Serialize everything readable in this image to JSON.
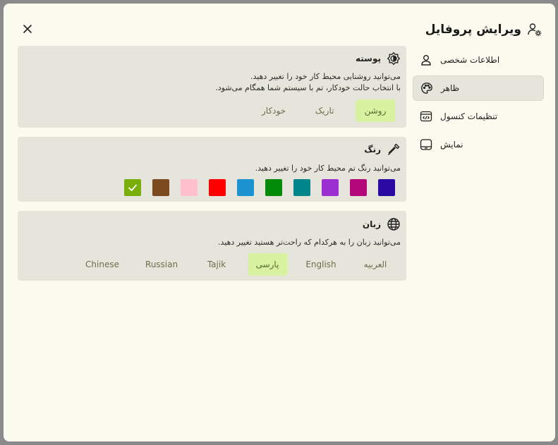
{
  "dialog": {
    "title": "ویرایش پروفایل",
    "title_icon": "user-gear-icon",
    "close_icon": "close-icon"
  },
  "nav": {
    "items": [
      {
        "label": "اطلاعات شخصی",
        "icon": "user-icon",
        "active": false
      },
      {
        "label": "ظاهر",
        "icon": "palette-icon",
        "active": true
      },
      {
        "label": "تنظیمات کنسول",
        "icon": "code-window-icon",
        "active": false
      },
      {
        "label": "نمایش",
        "icon": "display-icon",
        "active": false
      }
    ]
  },
  "skin": {
    "title": "پوسته",
    "icon": "brightness-icon",
    "desc1": "می‌توانید روشنایی محیط کار خود را تغییر دهید.",
    "desc2": "با انتخاب حالت خودکار، تم با سیستم شما همگام می‌شود.",
    "options": [
      "روشن",
      "تاریک",
      "خودکار"
    ],
    "selected": "روشن"
  },
  "color": {
    "title": "رنگ",
    "icon": "eyedropper-icon",
    "desc": "می‌توانید رنگ تم محیط کار خود را تغییر دهید.",
    "swatches": [
      "#2a0aa0",
      "#b3087c",
      "#9b2fd1",
      "#00858a",
      "#008a08",
      "#1e93d2",
      "#ff0000",
      "#ffc0cb",
      "#7b4a1e",
      "#7aae0a"
    ],
    "selected_index": 9
  },
  "language": {
    "title": "زبان",
    "icon": "globe-icon",
    "desc": "می‌توانید زبان را به هرکدام که راحت‌تر هستید تغییر دهید.",
    "options": [
      "العربیه",
      "English",
      "پارسی",
      "Tajik",
      "Russian",
      "Chinese"
    ],
    "selected": "پارسی"
  }
}
